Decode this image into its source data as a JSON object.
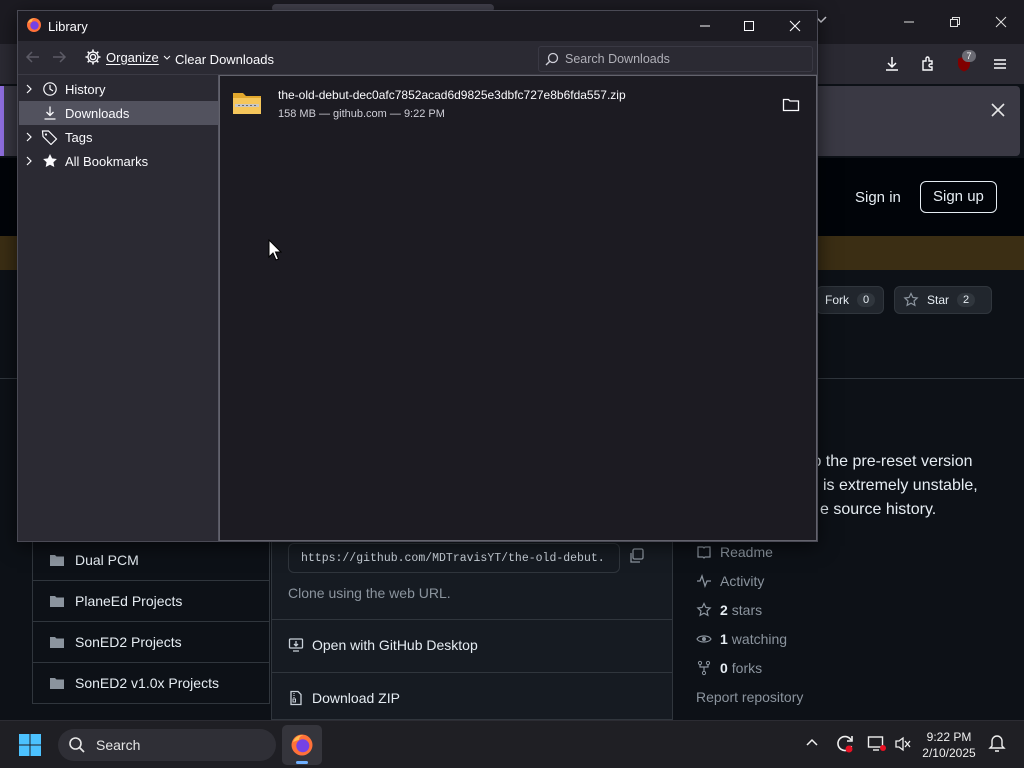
{
  "library": {
    "title": "Library",
    "toolbar": {
      "organize_label": "Organize",
      "clear_downloads_label": "Clear Downloads",
      "search_placeholder": "Search Downloads"
    },
    "tree": [
      {
        "label": "History",
        "icon": "history-icon",
        "expandable": true,
        "selected": false
      },
      {
        "label": "Downloads",
        "icon": "download-icon",
        "expandable": false,
        "selected": true
      },
      {
        "label": "Tags",
        "icon": "tag-icon",
        "expandable": true,
        "selected": false
      },
      {
        "label": "All Bookmarks",
        "icon": "star-icon",
        "expandable": true,
        "selected": false
      }
    ],
    "downloads": [
      {
        "filename": "the-old-debut-dec0afc7852acad6d9825e3dbfc727e8b6fda557.zip",
        "meta": "158 MB — github.com — 9:22 PM",
        "icon": "zip-folder-icon"
      }
    ]
  },
  "background": {
    "browser_badge": "7",
    "header": {
      "sign_in": "Sign in",
      "sign_up": "Sign up"
    },
    "repo_actions": {
      "fork_label": "Fork",
      "fork_count": "0",
      "star_label": "Star",
      "star_count": "2"
    },
    "about_lines": [
      "to the pre-reset version",
      "is extremely unstable,",
      "e source history."
    ],
    "files": [
      "Dual PCM",
      "PlaneEd Projects",
      "SonED2 Projects",
      "SonED2 v1.0x Projects"
    ],
    "clone": {
      "url": "https://github.com/MDTravisYT/the-old-debut.",
      "hint": "Clone using the web URL.",
      "open_desktop": "Open with GitHub Desktop",
      "download_zip": "Download ZIP"
    },
    "sidebar": {
      "readme": "Readme",
      "activity": "Activity",
      "stars_count": "2",
      "stars_label": "stars",
      "watching_count": "1",
      "watching_label": "watching",
      "forks_count": "0",
      "forks_label": "forks",
      "report": "Report repository"
    }
  },
  "taskbar": {
    "search_label": "Search",
    "time": "9:22 PM",
    "date": "2/10/2025"
  },
  "colors": {
    "accent": "#8f6fe0",
    "selected_row": "#52525e",
    "github_bg": "#0d1117"
  }
}
